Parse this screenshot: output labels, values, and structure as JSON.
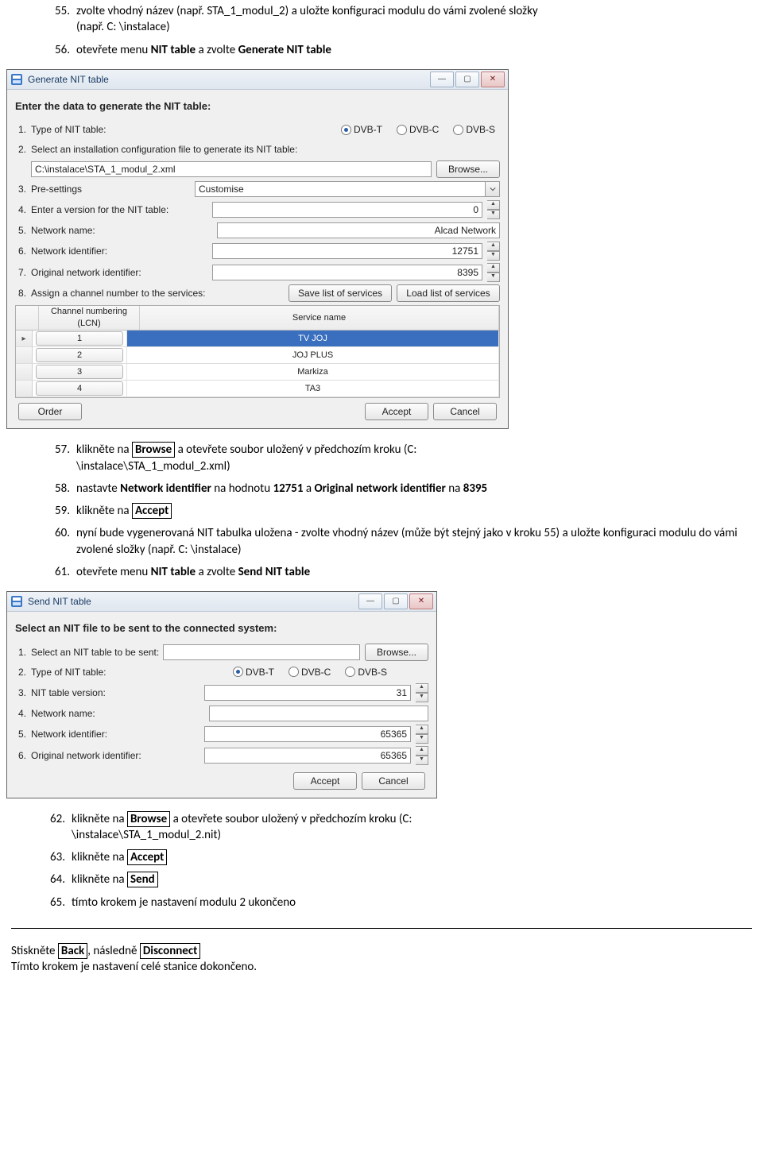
{
  "steps": {
    "s55": {
      "num": "55.",
      "text_a": "zvolte vhodný název (např. STA_1_modul_2) a uložte konfiguraci modulu do vámi zvolené složky",
      "text_b": "(např. C: \\instalace)"
    },
    "s56": {
      "num": "56.",
      "prefix": "otevřete menu ",
      "b1": "NIT table",
      "mid": " a zvolte ",
      "b2": "Generate NIT table"
    },
    "s57": {
      "num": "57.",
      "prefix": "klikněte na ",
      "boxed": "Browse",
      "suffix": " a otevřete soubor uložený v předchozím kroku (C:",
      "line2": "\\instalace\\STA_1_modul_2.xml)"
    },
    "s58": {
      "num": "58.",
      "prefix": "nastavte ",
      "b1": "Network identifier",
      "mid1": " na hodnotu ",
      "b2": "12751",
      "mid2": " a ",
      "b3": "Original network identifier",
      "mid3": " na ",
      "b4": "8395"
    },
    "s59": {
      "num": "59.",
      "prefix": "klikněte na ",
      "boxed": "Accept"
    },
    "s60": {
      "num": "60.",
      "text_a": "nyní bude vygenerovaná NIT tabulka uložena - zvolte vhodný název (může být stejný jako v kroku 55) a uložte konfiguraci modulu do vámi zvolené složky (např. C: \\instalace)"
    },
    "s61": {
      "num": "61.",
      "prefix": "otevřete menu ",
      "b1": "NIT table",
      "mid": " a zvolte ",
      "b2": "Send NIT table"
    },
    "s62": {
      "num": "62.",
      "prefix": "klikněte na ",
      "boxed": "Browse",
      "suffix": " a otevřete soubor uložený v předchozím kroku (C:",
      "line2": "\\instalace\\STA_1_modul_2.nit)"
    },
    "s63": {
      "num": "63.",
      "prefix": "klikněte na ",
      "boxed": "Accept"
    },
    "s64": {
      "num": "64.",
      "prefix": "klikněte na ",
      "boxed": "Send"
    },
    "s65": {
      "num": "65.",
      "text": "tímto krokem je nastavení modulu 2 ukončeno"
    }
  },
  "footer": {
    "l1_pre": "Stiskněte ",
    "l1_box1": "Back",
    "l1_mid": ", následně ",
    "l1_box2": "Disconnect",
    "l2": "Tímto krokem je nastavení celé stanice dokončeno."
  },
  "winbtn": {
    "min": "—",
    "max": "▢",
    "close": "✕"
  },
  "gen": {
    "title": "Generate NIT table",
    "intro": "Enter the data to generate the NIT table:",
    "r1_num": "1.",
    "r1_label": "Type of NIT table:",
    "radios": {
      "dvbt": "DVB-T",
      "dvbc": "DVB-C",
      "dvbs": "DVB-S"
    },
    "r2_num": "2.",
    "r2_label": "Select an installation configuration file to generate its NIT table:",
    "r2_val": "C:\\instalace\\STA_1_modul_2.xml",
    "browse": "Browse...",
    "r3_num": "3.",
    "r3_label": "Pre-settings",
    "r3_val": "Customise",
    "r4_num": "4.",
    "r4_label": "Enter a version for the NIT table:",
    "r4_val": "0",
    "r5_num": "5.",
    "r5_label": "Network name:",
    "r5_val": "Alcad Network",
    "r6_num": "6.",
    "r6_label": "Network identifier:",
    "r6_val": "12751",
    "r7_num": "7.",
    "r7_label": "Original network identifier:",
    "r7_val": "8395",
    "r8_num": "8.",
    "r8_label": "Assign a channel number to the services:",
    "r8_save": "Save list of services",
    "r8_load": "Load list of services",
    "grid": {
      "h1": "Channel numbering (LCN)",
      "h2": "Service name",
      "rows": [
        {
          "lcn": "1",
          "svc": "TV JOJ",
          "selected": true,
          "marker": "▸"
        },
        {
          "lcn": "2",
          "svc": "JOJ PLUS"
        },
        {
          "lcn": "3",
          "svc": "Markiza"
        },
        {
          "lcn": "4",
          "svc": "TA3"
        }
      ]
    },
    "order": "Order",
    "accept": "Accept",
    "cancel": "Cancel"
  },
  "send": {
    "title": "Send NIT table",
    "intro": "Select an NIT file to be sent to the connected system:",
    "r1_num": "1.",
    "r1_label": "Select an NIT table to be sent:",
    "r1_val": "",
    "browse": "Browse...",
    "r2_num": "2.",
    "r2_label": "Type of NIT table:",
    "radios": {
      "dvbt": "DVB-T",
      "dvbc": "DVB-C",
      "dvbs": "DVB-S"
    },
    "r3_num": "3.",
    "r3_label": "NIT table version:",
    "r3_val": "31",
    "r4_num": "4.",
    "r4_label": "Network name:",
    "r4_val": "",
    "r5_num": "5.",
    "r5_label": "Network identifier:",
    "r5_val": "65365",
    "r6_num": "6.",
    "r6_label": "Original network identifier:",
    "r6_val": "65365",
    "accept": "Accept",
    "cancel": "Cancel"
  }
}
